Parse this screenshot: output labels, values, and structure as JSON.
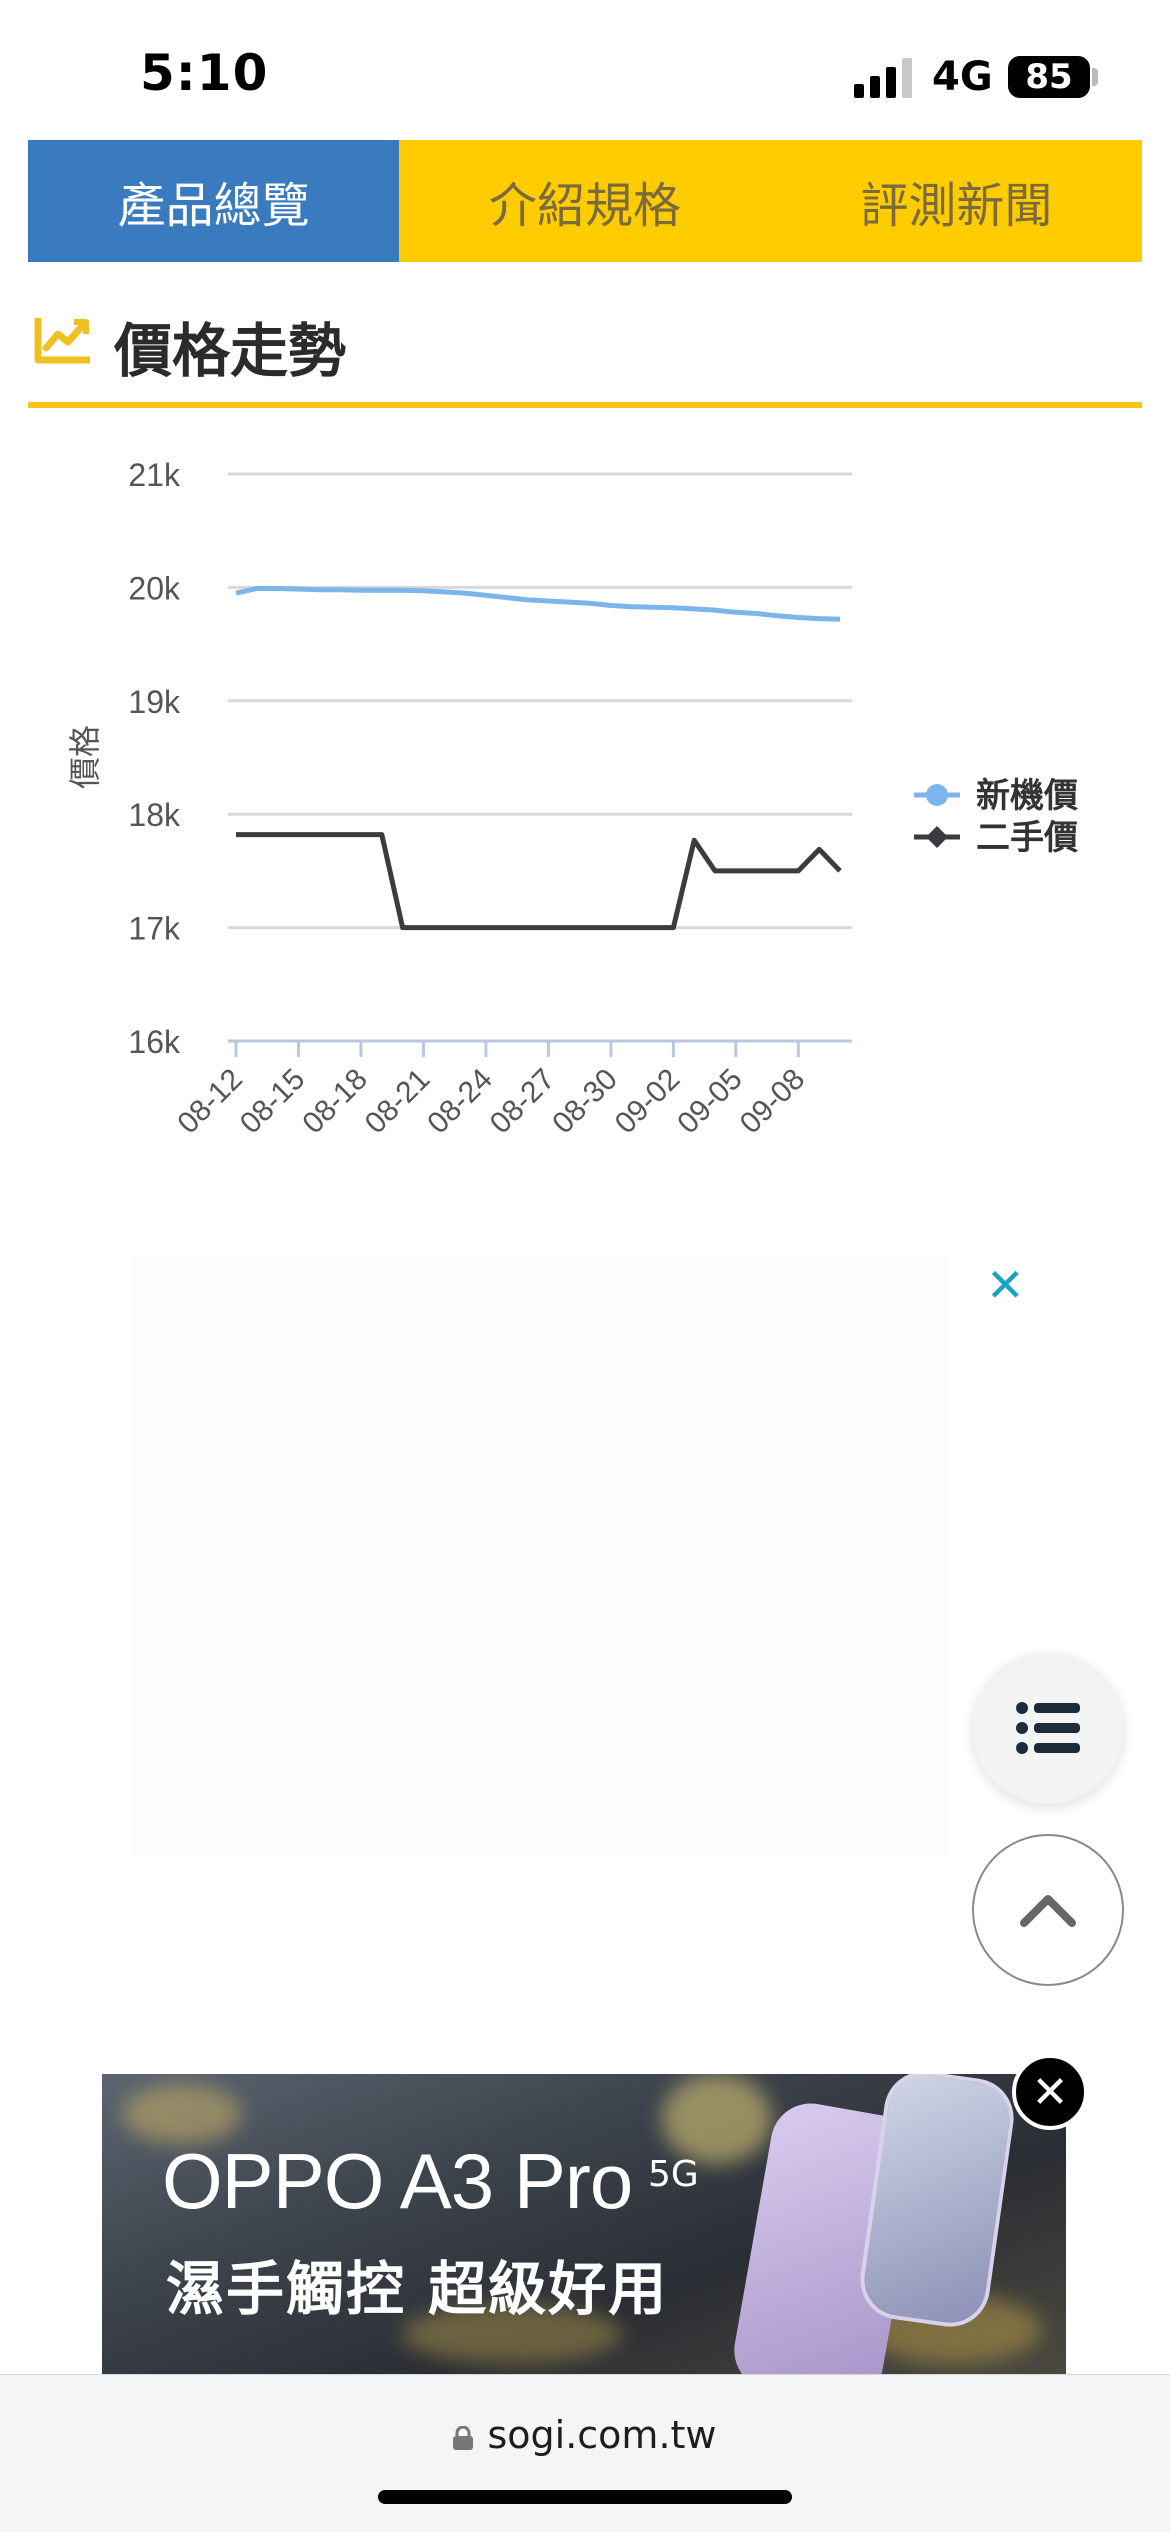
{
  "status_bar": {
    "time": "5:10",
    "network": "4G",
    "battery": "85"
  },
  "tabs": [
    {
      "label": "產品總覽",
      "active": true
    },
    {
      "label": "介紹規格",
      "active": false
    },
    {
      "label": "評測新聞",
      "active": false
    }
  ],
  "section": {
    "title": "價格走勢",
    "icon": "trend-chart-icon"
  },
  "chart_data": {
    "type": "line",
    "ylabel": "價格",
    "xlabel": "",
    "ylim": [
      16000,
      21000
    ],
    "y_ticks": [
      "16k",
      "17k",
      "18k",
      "19k",
      "20k",
      "21k"
    ],
    "x_ticks": [
      "08-12",
      "08-15",
      "08-18",
      "08-21",
      "08-24",
      "08-27",
      "08-30",
      "09-02",
      "09-05",
      "09-08"
    ],
    "x": [
      "08-12",
      "08-13",
      "08-14",
      "08-15",
      "08-16",
      "08-17",
      "08-18",
      "08-19",
      "08-20",
      "08-21",
      "08-22",
      "08-23",
      "08-24",
      "08-25",
      "08-26",
      "08-27",
      "08-28",
      "08-29",
      "08-30",
      "08-31",
      "09-01",
      "09-02",
      "09-03",
      "09-04",
      "09-05",
      "09-06",
      "09-07",
      "09-08",
      "09-09",
      "09-10"
    ],
    "legend_position": "right",
    "grid": true,
    "series": [
      {
        "name": "新機價",
        "color": "#7cb5ec",
        "marker": "circle",
        "values": [
          19950,
          19990,
          19990,
          19985,
          19980,
          19980,
          19975,
          19975,
          19975,
          19970,
          19960,
          19950,
          19930,
          19910,
          19890,
          19880,
          19870,
          19860,
          19840,
          19830,
          19825,
          19820,
          19810,
          19800,
          19780,
          19770,
          19750,
          19735,
          19725,
          19720
        ]
      },
      {
        "name": "二手價",
        "color": "#3b3b40",
        "marker": "diamond",
        "values": [
          17820,
          17820,
          17820,
          17820,
          17820,
          17820,
          17820,
          17820,
          17000,
          17000,
          17000,
          17000,
          17000,
          17000,
          17000,
          17000,
          17000,
          17000,
          17000,
          17000,
          17000,
          17000,
          17770,
          17500,
          17500,
          17500,
          17500,
          17500,
          17690,
          17500
        ]
      }
    ]
  },
  "ad": {
    "close_label": "✕"
  },
  "floating_buttons": {
    "menu_icon": "list-icon",
    "top_icon": "chevron-up-icon"
  },
  "banner": {
    "title": "OPPO A3 Pro",
    "superscript": "5G",
    "subtitle": "濕手觸控 超級好用",
    "close_label": "✕"
  },
  "url_bar": {
    "domain": "sogi.com.tw"
  }
}
